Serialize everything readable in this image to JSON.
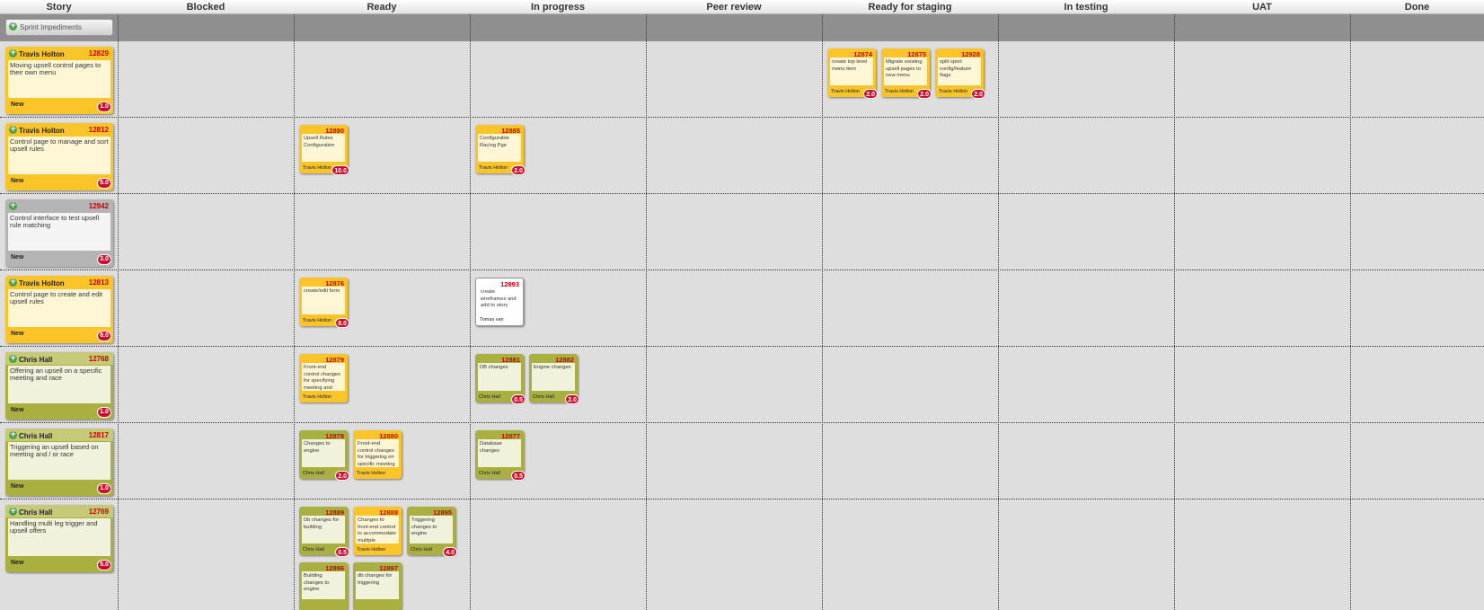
{
  "columns": [
    "Story",
    "Blocked",
    "Ready",
    "In progress",
    "Peer review",
    "Ready for staging",
    "In testing",
    "UAT",
    "Done"
  ],
  "impediments_label": "Sprint Impediments",
  "stories": [
    {
      "owner": "Travis Holton",
      "id": "12829",
      "desc": "Moving upsell control pages to their own menu",
      "status": "New",
      "points": "1.0",
      "theme": "yellow"
    },
    {
      "owner": "Travis Holton",
      "id": "12812",
      "desc": "Control page to manage and sort upsell rules",
      "status": "New",
      "points": "5.0",
      "theme": "yellow"
    },
    {
      "owner": "",
      "id": "12942",
      "desc": "Control interface to test upsell rule matching",
      "status": "New",
      "points": "3.0",
      "theme": "gray"
    },
    {
      "owner": "Travis Holton",
      "id": "12813",
      "desc": "Control page to create and edit upsell rules",
      "status": "New",
      "points": "8.0",
      "theme": "yellow"
    },
    {
      "owner": "Chris Hall",
      "id": "12768",
      "desc": "Offering an upsell on a specific meeting and race",
      "status": "New",
      "points": "1.0",
      "theme": "green"
    },
    {
      "owner": "Chris Hall",
      "id": "12817",
      "desc": "Triggering an upsell based on meeting and / or race",
      "status": "New",
      "points": "1.0",
      "theme": "green"
    },
    {
      "owner": "Chris Hall",
      "id": "12769",
      "desc": "Handling multi leg trigger and upsell offers",
      "status": "New",
      "points": "5.0",
      "theme": "green"
    }
  ],
  "tasks": [
    {
      "row": 0,
      "col": 5,
      "slot": 0,
      "id": "12874",
      "desc": "create top level menu item",
      "owner": "Travis Holton",
      "hours": "2.0",
      "theme": "y"
    },
    {
      "row": 0,
      "col": 5,
      "slot": 1,
      "id": "12875",
      "desc": "Migrate existing upsell pages to new menu",
      "owner": "Travis Holton",
      "hours": "2.0",
      "theme": "y"
    },
    {
      "row": 0,
      "col": 5,
      "slot": 2,
      "id": "12928",
      "desc": "split sport config/feature flags",
      "owner": "Travis Holton",
      "hours": "2.0",
      "theme": "y"
    },
    {
      "row": 1,
      "col": 2,
      "slot": 0,
      "id": "12890",
      "desc": "Upsell Rules Configuration",
      "owner": "Travis Holton",
      "hours": "10.0",
      "theme": "y"
    },
    {
      "row": 1,
      "col": 3,
      "slot": 0,
      "id": "12885",
      "desc": "Configurable Racing Pge",
      "owner": "Travis Holton",
      "hours": "2.0",
      "theme": "y"
    },
    {
      "row": 3,
      "col": 2,
      "slot": 0,
      "id": "12876",
      "desc": "create/edit form",
      "owner": "Travis Holton",
      "hours": "8.0",
      "theme": "y"
    },
    {
      "row": 3,
      "col": 3,
      "slot": 0,
      "id": "12893",
      "desc": "create wireframes and add to story",
      "owner": "Tomas van",
      "hours": "",
      "theme": "w"
    },
    {
      "row": 4,
      "col": 2,
      "slot": 0,
      "id": "12879",
      "desc": "Front-end control changes for specifying meeting and race to",
      "owner": "Travis Holton",
      "hours": "",
      "theme": "y"
    },
    {
      "row": 4,
      "col": 3,
      "slot": 0,
      "id": "12881",
      "desc": "DB changes",
      "owner": "Chris Hall",
      "hours": "0.5",
      "theme": "g"
    },
    {
      "row": 4,
      "col": 3,
      "slot": 1,
      "id": "12882",
      "desc": "Engine changes",
      "owner": "Chris Hall",
      "hours": "2.0",
      "theme": "g"
    },
    {
      "row": 5,
      "col": 2,
      "slot": 0,
      "id": "12878",
      "desc": "Changes to engine",
      "owner": "Chris Hall",
      "hours": "2.0",
      "theme": "g"
    },
    {
      "row": 5,
      "col": 2,
      "slot": 1,
      "id": "12880",
      "desc": "Front-end control changes for triggering on specific meeting",
      "owner": "Travis Holton",
      "hours": "",
      "theme": "y"
    },
    {
      "row": 5,
      "col": 3,
      "slot": 0,
      "id": "12877",
      "desc": "Database changes",
      "owner": "Chris Hall",
      "hours": "0.5",
      "theme": "g"
    },
    {
      "row": 6,
      "col": 2,
      "slot": 0,
      "id": "12889",
      "desc": "Db changes for building",
      "owner": "Chris Hall",
      "hours": "0.5",
      "theme": "g"
    },
    {
      "row": 6,
      "col": 2,
      "slot": 1,
      "id": "12888",
      "desc": "Changes to front-end control to accommodate multiple",
      "owner": "Travis Holton",
      "hours": "",
      "theme": "y"
    },
    {
      "row": 6,
      "col": 2,
      "slot": 2,
      "id": "12895",
      "desc": "Triggering changes to engine",
      "owner": "Chris Hall",
      "hours": "4.0",
      "theme": "g"
    },
    {
      "row": 6,
      "col": 2,
      "slot": 3,
      "id": "12896",
      "desc": "Building changes to engine",
      "owner": "",
      "hours": "",
      "theme": "g"
    },
    {
      "row": 6,
      "col": 2,
      "slot": 4,
      "id": "12897",
      "desc": "db changes for triggering",
      "owner": "",
      "hours": "",
      "theme": "g"
    }
  ]
}
